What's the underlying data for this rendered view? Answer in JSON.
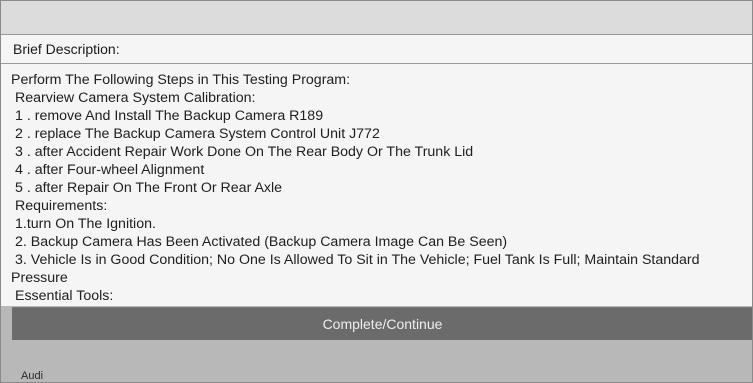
{
  "header": {
    "title": "Brief Description:"
  },
  "content": {
    "lines": [
      "Perform The Following Steps in This Testing Program:",
      "Rearview Camera System Calibration:",
      "1 . remove And Install The Backup Camera R189",
      "2 . replace The Backup Camera System Control Unit J772",
      "3 . after Accident Repair Work Done On The Rear Body Or The Trunk Lid",
      "4 . after Four-wheel Alignment",
      "5 . after Repair On The Front Or Rear Axle",
      "Requirements:",
      "1.turn On The Ignition.",
      "2. Backup Camera Has Been Activated (Backup Camera Image Can Be Seen)",
      "3. Vehicle Is in Good Condition; No One Is Allowed To Sit in The Vehicle; Fuel Tank Is Full; Maintain Standard",
      "Pressure",
      "Essential Tools:"
    ]
  },
  "actions": {
    "complete_label": "Complete/Continue"
  },
  "footer": {
    "brand": "Audi"
  },
  "colors": {
    "background": "#b8b8b8",
    "panel": "#f5f5f5",
    "button": "#6b6b6b",
    "button_text": "#eeeeee"
  }
}
